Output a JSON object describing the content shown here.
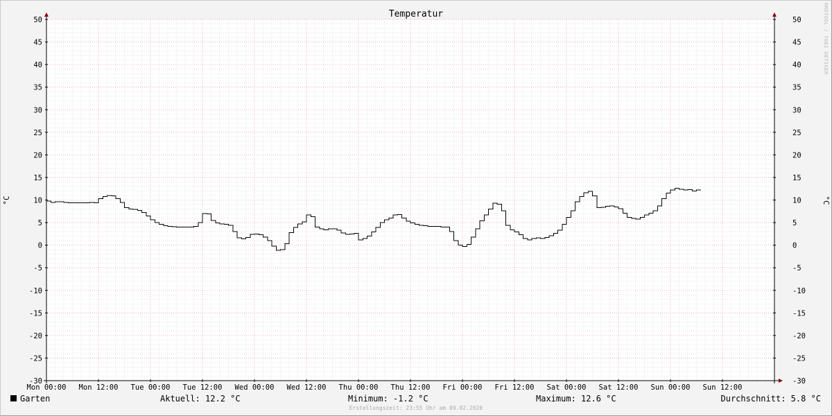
{
  "chart_data": {
    "type": "line",
    "title": "Temperatur",
    "ylabel": "°C",
    "ylabel_right": "°C",
    "ylim": [
      -30,
      50
    ],
    "yticks": [
      50,
      45,
      40,
      35,
      30,
      25,
      20,
      15,
      10,
      5,
      0,
      -5,
      -10,
      -15,
      -20,
      -25,
      -30
    ],
    "x_tick_labels": [
      "Mon 00:00",
      "Mon 12:00",
      "Tue 00:00",
      "Tue 12:00",
      "Wed 00:00",
      "Wed 12:00",
      "Thu 00:00",
      "Thu 12:00",
      "Fri 00:00",
      "Fri 12:00",
      "Sat 00:00",
      "Sat 12:00",
      "Sun 00:00",
      "Sun 12:00"
    ],
    "x_unit": "hours since Mon 00:00",
    "x_range": [
      0,
      168
    ],
    "grid": true,
    "series": [
      {
        "name": "Garten",
        "color": "#000000",
        "points": [
          [
            0,
            9.8
          ],
          [
            1,
            9.5
          ],
          [
            2,
            9.6
          ],
          [
            3,
            9.6
          ],
          [
            4,
            9.5
          ],
          [
            5,
            9.4
          ],
          [
            6,
            9.4
          ],
          [
            7,
            9.4
          ],
          [
            8,
            9.4
          ],
          [
            9,
            9.4
          ],
          [
            10,
            9.5
          ],
          [
            11,
            9.4
          ],
          [
            12,
            10.3
          ],
          [
            13,
            10.8
          ],
          [
            14,
            11.0
          ],
          [
            15,
            10.9
          ],
          [
            16,
            10.3
          ],
          [
            17,
            9.5
          ],
          [
            18,
            8.3
          ],
          [
            19,
            8.0
          ],
          [
            20,
            7.9
          ],
          [
            21,
            7.7
          ],
          [
            22,
            7.2
          ],
          [
            23,
            6.5
          ],
          [
            24,
            5.6
          ],
          [
            25,
            5.0
          ],
          [
            26,
            4.6
          ],
          [
            27,
            4.3
          ],
          [
            28,
            4.2
          ],
          [
            29,
            4.1
          ],
          [
            30,
            4.0
          ],
          [
            31,
            4.0
          ],
          [
            32,
            4.0
          ],
          [
            33,
            4.0
          ],
          [
            34,
            4.2
          ],
          [
            35,
            5.0
          ],
          [
            36,
            7.0
          ],
          [
            37,
            6.9
          ],
          [
            38,
            5.5
          ],
          [
            39,
            4.9
          ],
          [
            40,
            4.7
          ],
          [
            41,
            4.6
          ],
          [
            42,
            4.4
          ],
          [
            43,
            3.0
          ],
          [
            44,
            1.6
          ],
          [
            45,
            1.4
          ],
          [
            46,
            1.7
          ],
          [
            47,
            2.4
          ],
          [
            48,
            2.5
          ],
          [
            49,
            2.3
          ],
          [
            50,
            1.8
          ],
          [
            51,
            1.0
          ],
          [
            52,
            -0.2
          ],
          [
            53,
            -1.1
          ],
          [
            54,
            -1.0
          ],
          [
            55,
            0.3
          ],
          [
            56,
            2.8
          ],
          [
            57,
            3.9
          ],
          [
            58,
            4.7
          ],
          [
            59,
            5.2
          ],
          [
            60,
            6.7
          ],
          [
            61,
            6.3
          ],
          [
            62,
            4.0
          ],
          [
            63,
            3.6
          ],
          [
            64,
            3.4
          ],
          [
            65,
            3.6
          ],
          [
            66,
            3.6
          ],
          [
            67,
            3.3
          ],
          [
            68,
            2.7
          ],
          [
            69,
            2.4
          ],
          [
            70,
            2.5
          ],
          [
            71,
            2.6
          ],
          [
            72,
            1.2
          ],
          [
            73,
            1.5
          ],
          [
            74,
            2.0
          ],
          [
            75,
            2.9
          ],
          [
            76,
            3.9
          ],
          [
            77,
            5.0
          ],
          [
            78,
            5.6
          ],
          [
            79,
            6.0
          ],
          [
            80,
            6.7
          ],
          [
            81,
            6.8
          ],
          [
            82,
            6.0
          ],
          [
            83,
            5.3
          ],
          [
            84,
            4.9
          ],
          [
            85,
            4.6
          ],
          [
            86,
            4.4
          ],
          [
            87,
            4.3
          ],
          [
            88,
            4.2
          ],
          [
            89,
            4.2
          ],
          [
            90,
            4.2
          ],
          [
            91,
            4.0
          ],
          [
            92,
            4.0
          ],
          [
            93,
            3.0
          ],
          [
            94,
            1.0
          ],
          [
            95,
            0.0
          ],
          [
            96,
            -0.3
          ],
          [
            97,
            0.2
          ],
          [
            98,
            1.8
          ],
          [
            99,
            3.6
          ],
          [
            100,
            5.4
          ],
          [
            101,
            6.7
          ],
          [
            102,
            8.0
          ],
          [
            103,
            9.3
          ],
          [
            104,
            9.1
          ],
          [
            105,
            7.6
          ],
          [
            106,
            4.4
          ],
          [
            107,
            3.4
          ],
          [
            108,
            2.9
          ],
          [
            109,
            2.3
          ],
          [
            110,
            1.5
          ],
          [
            111,
            1.2
          ],
          [
            112,
            1.5
          ],
          [
            113,
            1.6
          ],
          [
            114,
            1.5
          ],
          [
            115,
            1.7
          ],
          [
            116,
            2.1
          ],
          [
            117,
            2.6
          ],
          [
            118,
            3.3
          ],
          [
            119,
            4.6
          ],
          [
            120,
            6.2
          ],
          [
            121,
            7.6
          ],
          [
            122,
            9.6
          ],
          [
            123,
            10.8
          ],
          [
            124,
            11.6
          ],
          [
            125,
            11.9
          ],
          [
            126,
            10.9
          ],
          [
            127,
            8.3
          ],
          [
            128,
            8.4
          ],
          [
            129,
            8.6
          ],
          [
            130,
            8.7
          ],
          [
            131,
            8.5
          ],
          [
            132,
            8.1
          ],
          [
            133,
            7.1
          ],
          [
            134,
            6.2
          ],
          [
            135,
            5.9
          ],
          [
            136,
            5.8
          ],
          [
            137,
            6.2
          ],
          [
            138,
            6.7
          ],
          [
            139,
            7.1
          ],
          [
            140,
            7.6
          ],
          [
            141,
            8.7
          ],
          [
            142,
            10.3
          ],
          [
            143,
            11.5
          ],
          [
            144,
            12.2
          ],
          [
            145,
            12.6
          ],
          [
            146,
            12.4
          ],
          [
            147,
            12.2
          ],
          [
            148,
            12.3
          ],
          [
            149,
            12.0
          ],
          [
            150,
            12.2
          ]
        ]
      }
    ]
  },
  "legend": {
    "series_name": "Garten",
    "current": "Aktuell: 12.2 °C",
    "minimum": "Minimum: -1.2 °C",
    "maximum": "Maximum: 12.6 °C",
    "average": "Durchschnitt: 5.8 °C"
  },
  "footer": {
    "created": "Erstellungszeit: 23:55 Uhr am 09.02.2020"
  },
  "watermark": "RRDTOOL / TOBI OETIKER",
  "colors": {
    "background": "#f3f3f3",
    "plot_background": "#ffffff",
    "major_grid": "#e4a0a0",
    "minor_grid": "#d0d0d0",
    "axis": "#000000",
    "arrow": "#8b0000",
    "line": "#000000"
  }
}
